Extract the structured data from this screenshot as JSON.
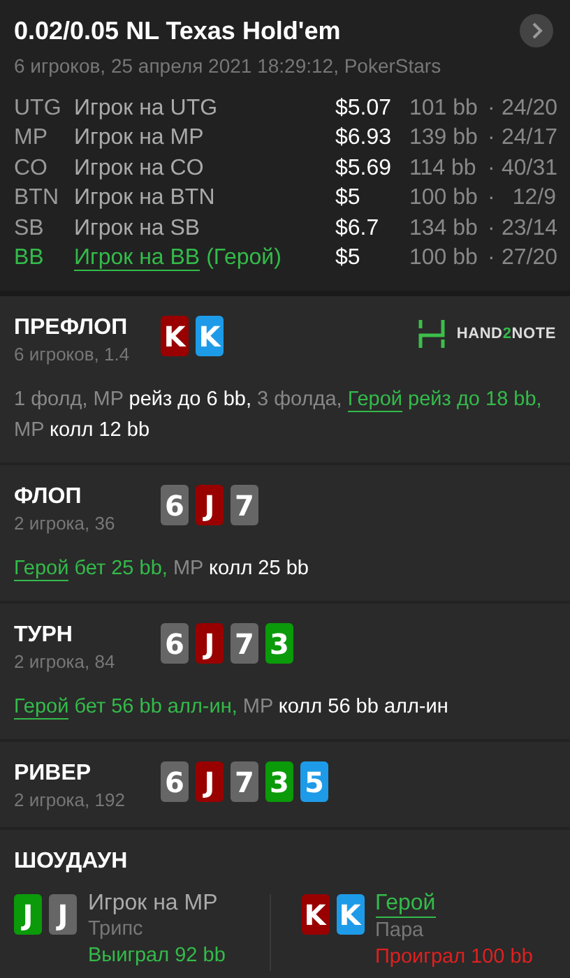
{
  "header": {
    "title": "0.02/0.05 NL Texas Hold'em",
    "subtitle": "6 игроков, 25 апреля 2021 18:29:12, PokerStars"
  },
  "players": [
    {
      "position": "UTG",
      "name": "Игрок на UTG",
      "hero": false,
      "stack": "$5.07",
      "bb": "101 bb",
      "sep": "·",
      "stats": "24/20"
    },
    {
      "position": "MP",
      "name": "Игрок на MP",
      "hero": false,
      "stack": "$6.93",
      "bb": "139 bb",
      "sep": "·",
      "stats": "24/17"
    },
    {
      "position": "CO",
      "name": "Игрок на CO",
      "hero": false,
      "stack": "$5.69",
      "bb": "114 bb",
      "sep": "·",
      "stats": "40/31"
    },
    {
      "position": "BTN",
      "name": "Игрок на BTN",
      "hero": false,
      "stack": "$5",
      "bb": "100 bb",
      "sep": "·",
      "stats": "12/9"
    },
    {
      "position": "SB",
      "name": "Игрок на SB",
      "hero": false,
      "stack": "$6.7",
      "bb": "134 bb",
      "sep": "·",
      "stats": "23/14"
    },
    {
      "position": "BB",
      "name": "Игрок на BB",
      "hero": true,
      "hero_tag": "(Герой)",
      "stack": "$5",
      "bb": "100 bb",
      "sep": "·",
      "stats": "27/20"
    }
  ],
  "streets": [
    {
      "name": "ПРЕФЛОП",
      "info": "6 игроков, 1.4",
      "logo": [
        "HAND",
        "2",
        "NOTE"
      ],
      "cards": [
        {
          "rank": "K",
          "color": "#990000"
        },
        {
          "rank": "K",
          "color": "#1e9be8"
        }
      ],
      "actions": [
        {
          "kind": "muted",
          "text": "1 фолд, MP "
        },
        {
          "kind": "white",
          "text": "рейз до 6 bb,"
        },
        {
          "kind": "muted",
          "text": " 3 фолда, "
        },
        {
          "kind": "hero_link",
          "text": "Герой"
        },
        {
          "kind": "hero",
          "text": " рейз до 18 bb,"
        },
        {
          "kind": "muted",
          "text": " MP "
        },
        {
          "kind": "white",
          "text": "колл 12 bb"
        }
      ]
    },
    {
      "name": "ФЛОП",
      "info": "2 игрока, 36",
      "cards": [
        {
          "rank": "6",
          "color": "#666666"
        },
        {
          "rank": "J",
          "color": "#990000"
        },
        {
          "rank": "7",
          "color": "#666666"
        }
      ],
      "actions": [
        {
          "kind": "hero_link",
          "text": "Герой"
        },
        {
          "kind": "hero",
          "text": " бет 25 bb,"
        },
        {
          "kind": "muted",
          "text": " MP "
        },
        {
          "kind": "white",
          "text": "колл 25 bb"
        }
      ]
    },
    {
      "name": "ТУРН",
      "info": "2 игрока, 84",
      "cards": [
        {
          "rank": "6",
          "color": "#666666"
        },
        {
          "rank": "J",
          "color": "#990000"
        },
        {
          "rank": "7",
          "color": "#666666"
        },
        {
          "rank": "3",
          "color": "#0a9a0a"
        }
      ],
      "actions": [
        {
          "kind": "hero_link",
          "text": "Герой"
        },
        {
          "kind": "hero",
          "text": " бет 56 bb алл-ин,"
        },
        {
          "kind": "muted",
          "text": " MP "
        },
        {
          "kind": "white",
          "text": "колл 56 bb алл-ин"
        }
      ]
    },
    {
      "name": "РИВЕР",
      "info": "2 игрока, 192",
      "cards": [
        {
          "rank": "6",
          "color": "#666666"
        },
        {
          "rank": "J",
          "color": "#990000"
        },
        {
          "rank": "7",
          "color": "#666666"
        },
        {
          "rank": "3",
          "color": "#0a9a0a"
        },
        {
          "rank": "5",
          "color": "#1e9be8"
        }
      ]
    }
  ],
  "showdown": {
    "title": "ШОУДАУН",
    "hands": [
      {
        "cards": [
          {
            "rank": "J",
            "color": "#0a9a0a"
          },
          {
            "rank": "J",
            "color": "#666666"
          }
        ],
        "player": "Игрок на MP",
        "hero": false,
        "combo": "Трипс",
        "result": "Выиграл 92 bb",
        "won": true
      },
      {
        "cards": [
          {
            "rank": "K",
            "color": "#990000"
          },
          {
            "rank": "K",
            "color": "#1e9be8"
          }
        ],
        "player": "Герой",
        "hero": true,
        "combo": "Пара",
        "result": "Проиграл 100 bb",
        "won": false
      }
    ]
  }
}
